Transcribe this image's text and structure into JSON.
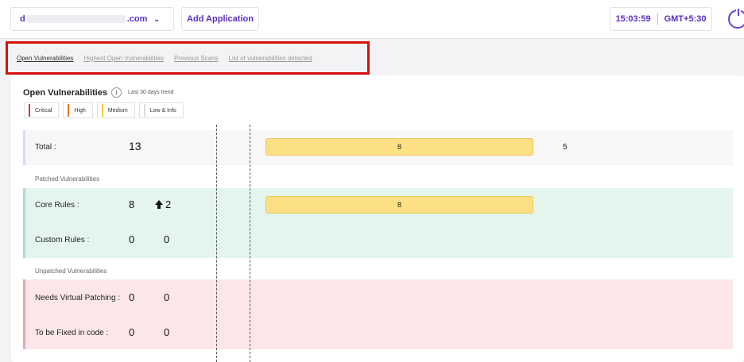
{
  "header": {
    "domain_prefix": "d",
    "domain_suffix": ".com",
    "add_application_label": "Add Application",
    "time": "15:03:59",
    "timezone": "GMT+5:30"
  },
  "tabs": [
    {
      "label": "Open Vulnerabilities",
      "active": true
    },
    {
      "label": "Highest Open Vulnerabilities",
      "active": false
    },
    {
      "label": "Previous Scans",
      "active": false
    },
    {
      "label": "List of vulnerabilities detected",
      "active": false
    }
  ],
  "card": {
    "title": "Open Vulnerabilities",
    "info_icon": "i",
    "trend_label": "Last 30 days trend"
  },
  "legend": [
    {
      "label": "Critical",
      "color": "#e0313d"
    },
    {
      "label": "High",
      "color": "#f07a2a"
    },
    {
      "label": "Medium",
      "color": "#f5c23a"
    },
    {
      "label": "Low & Info",
      "color": "#dddddd"
    }
  ],
  "rows": {
    "total": {
      "label": "Total :",
      "count": "13",
      "medium_value": "8",
      "remaining_value": "5"
    },
    "patched_heading": "Patched Vulnerabilities",
    "core_rules": {
      "label": "Core Rules :",
      "count": "8",
      "delta": "2",
      "medium_value": "8"
    },
    "custom_rules": {
      "label": "Custom Rules :",
      "count": "0",
      "delta": "0"
    },
    "unpatched_heading": "Unpatched Vulnerabilities",
    "needs_virtual_patching": {
      "label": "Needs Virtual Patching :",
      "count": "0",
      "delta": "0"
    },
    "fixed_in_code": {
      "label": "To be Fixed in code :",
      "count": "0",
      "delta": "0"
    }
  }
}
